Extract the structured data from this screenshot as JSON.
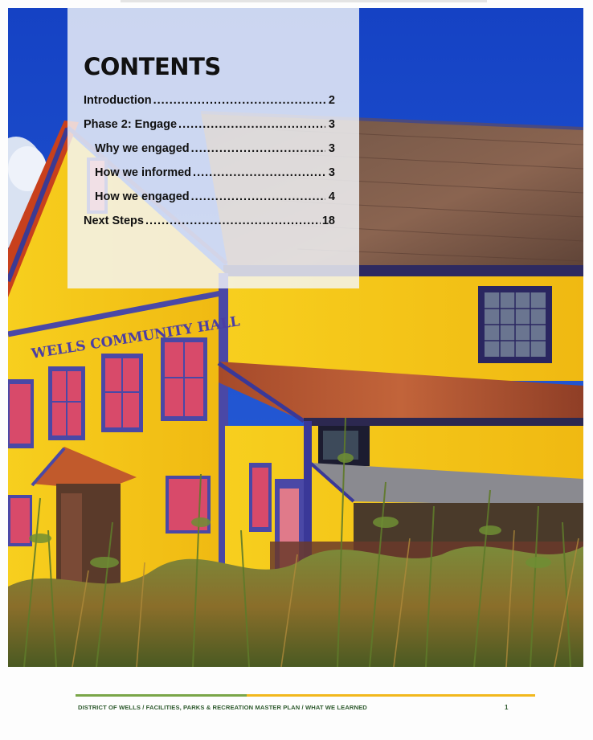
{
  "contents": {
    "title": "CONTENTS",
    "entries": [
      {
        "label": "Introduction",
        "page": "2",
        "level": 1
      },
      {
        "label": "Phase 2: Engage",
        "page": "3",
        "level": 1
      },
      {
        "label": "Why we engaged",
        "page": "3",
        "level": 2
      },
      {
        "label": "How we informed",
        "page": "3",
        "level": 2
      },
      {
        "label": "How we engaged",
        "page": "4",
        "level": 2
      },
      {
        "label": "Next Steps",
        "page": "18",
        "level": 1
      }
    ]
  },
  "photo": {
    "sign_text": "WELLS COMMUNITY HALL"
  },
  "footer": {
    "text": "DISTRICT OF WELLS / FACILITIES, PARKS & RECREATION MASTER PLAN / WHAT WE LEARNED",
    "page_number": "1"
  },
  "colors": {
    "sky": "#1e4fcf",
    "building_yellow": "#f2c51a",
    "trim_purple": "#5a56b8",
    "roof_brown": "#7a5a4a",
    "footer_green": "#7aa649",
    "footer_yellow": "#f2b81d",
    "footer_text": "#2e5a2e"
  }
}
